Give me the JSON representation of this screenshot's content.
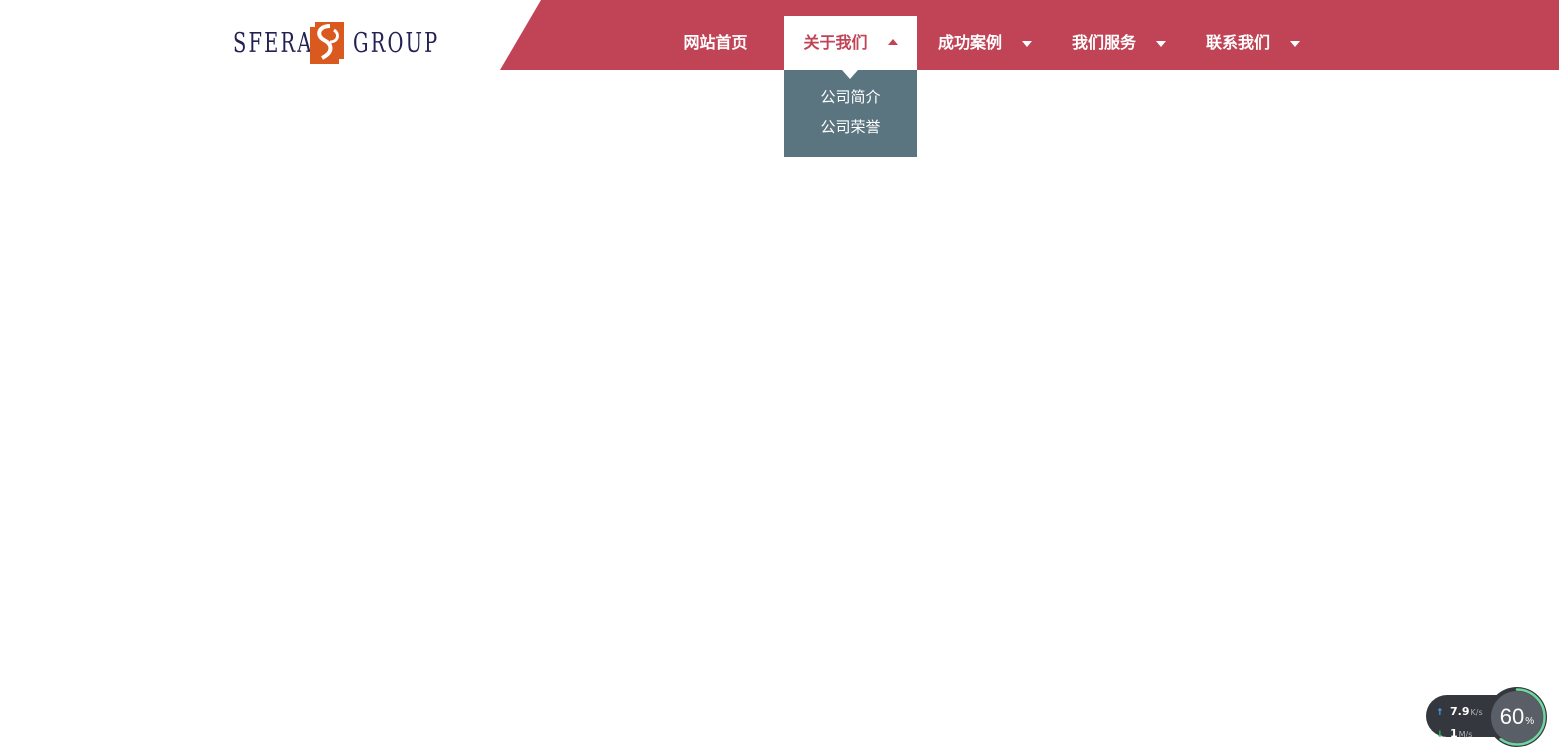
{
  "logo": {
    "left_text": "SFERA",
    "right_text": "GROUP",
    "brand_color": "#232052",
    "mark_color": "#d9591f"
  },
  "colors": {
    "nav_bg": "#c04456",
    "dropdown_bg": "#5b7580"
  },
  "nav": {
    "items": [
      {
        "label": "网站首页",
        "has_caret": false,
        "active": false
      },
      {
        "label": "关于我们",
        "has_caret": true,
        "active": true
      },
      {
        "label": "成功案例",
        "has_caret": true,
        "active": false
      },
      {
        "label": "我们服务",
        "has_caret": true,
        "active": false
      },
      {
        "label": "联系我们",
        "has_caret": true,
        "active": false
      }
    ]
  },
  "dropdown": {
    "items": [
      "公司简介",
      "公司荣誉"
    ]
  },
  "speed_widget": {
    "upload_value": "7.9",
    "upload_unit": "K/s",
    "download_value": "1",
    "download_unit": "M/s",
    "percent": "60",
    "percent_sign": "%",
    "level": 0.6
  }
}
